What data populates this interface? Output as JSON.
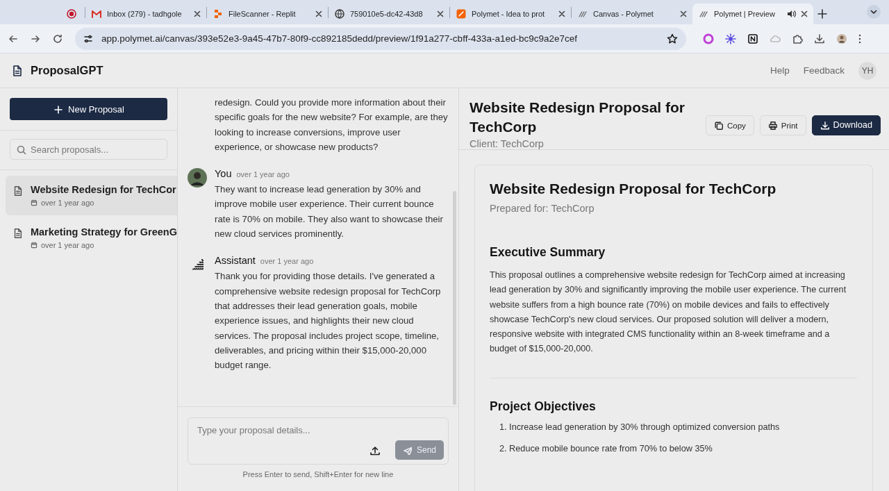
{
  "browser": {
    "tabs": [
      {
        "kind": "pinned",
        "selected": false
      },
      {
        "kind": "page",
        "label": "Inbox (279) - tadhgole",
        "selected": false
      },
      {
        "kind": "page",
        "label": "FileScanner - Replit",
        "selected": false
      },
      {
        "kind": "page",
        "label": "759010e5-dc42-43d8",
        "selected": false
      },
      {
        "kind": "page",
        "label": "Polymet - Idea to prot",
        "selected": false
      },
      {
        "kind": "page",
        "label": "Canvas - Polymet",
        "selected": false
      },
      {
        "kind": "page",
        "label": "Polymet | Preview",
        "selected": true
      }
    ],
    "url": "app.polymet.ai/canvas/393e52e3-9a45-47b7-80f9-cc892185dedd/preview/1f91a277-cbff-433a-a1ed-bc9c9a2e7cef"
  },
  "header": {
    "title": "ProposalGPT",
    "links": [
      "Help",
      "Feedback"
    ],
    "avatar": "YH"
  },
  "sidebar": {
    "new_button": "New Proposal",
    "search_placeholder": "Search proposals...",
    "items": [
      {
        "title": "Website Redesign for TechCor",
        "date": "over 1 year ago",
        "selected": true
      },
      {
        "title": "Marketing Strategy for GreenG",
        "date": "over 1 year ago",
        "selected": false
      }
    ]
  },
  "chat": {
    "messages": [
      {
        "kind": "assistant",
        "text": "redesign. Could you provide more information about their specific goals for the new website? For example, are they looking to increase conversions, improve user experience, or showcase new products?"
      },
      {
        "kind": "user",
        "author": "You",
        "time": "over 1 year ago",
        "text": "They want to increase lead generation by 30% and improve mobile user experience. Their current bounce rate is 70% on mobile. They also want to showcase their new cloud services prominently."
      },
      {
        "kind": "assistant",
        "author": "Assistant",
        "time": "over 1 year ago",
        "text": "Thank you for providing those details. I've generated a comprehensive website redesign proposal for TechCorp that addresses their lead generation goals, mobile experience issues, and highlights their new cloud services. The proposal includes project scope, timeline, deliverables, and pricing within their $15,000-20,000 budget range."
      }
    ],
    "input_placeholder": "Type your proposal details...",
    "send": {
      "label": "Send",
      "disabled": true
    },
    "hint": "Press Enter to send, Shift+Enter for new line"
  },
  "preview": {
    "title": "Website Redesign Proposal for TechCorp",
    "client": "Client: TechCorp",
    "actions": [
      {
        "kind": "copy",
        "label": "Copy",
        "primary": false
      },
      {
        "kind": "print",
        "label": "Print",
        "primary": false
      },
      {
        "kind": "download",
        "label": "Download",
        "primary": true
      }
    ],
    "document": {
      "title": "Website Redesign Proposal for TechCorp",
      "subtitle": "Prepared for: TechCorp",
      "sections": [
        {
          "heading": "Executive Summary",
          "paragraph": "This proposal outlines a comprehensive website redesign for TechCorp aimed at increasing lead generation by 30% and significantly improving the mobile user experience. The current website suffers from a high bounce rate (70%) on mobile devices and fails to effectively showcase TechCorp's new cloud services. Our proposed solution will deliver a modern, responsive website with integrated CMS functionality within an 8-week timeframe and a budget of $15,000-20,000."
        },
        {
          "heading": "Project Objectives",
          "items": [
            "1. Increase lead generation by 30% through optimized conversion paths",
            "2. Reduce mobile bounce rate from 70% to below 35%"
          ]
        }
      ]
    }
  }
}
